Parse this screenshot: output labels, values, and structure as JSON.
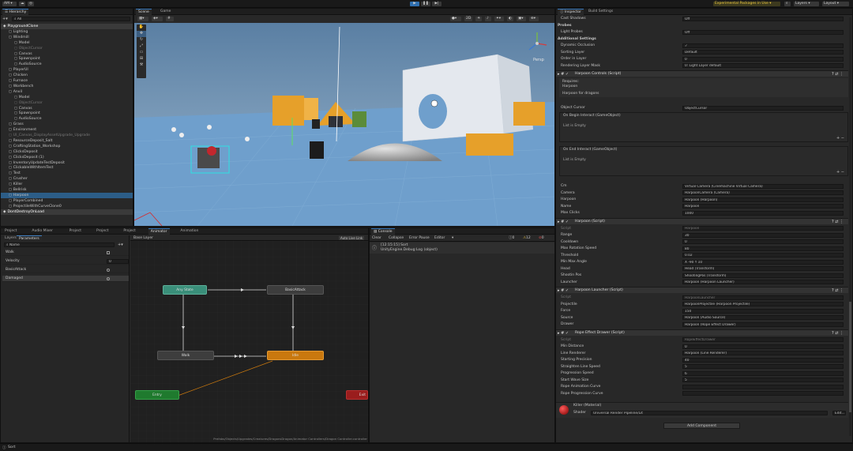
{
  "toolbar": {
    "account": "AM",
    "experimental": "Experimental Packages in Use",
    "layers": "Layers",
    "layout": "Layout"
  },
  "hierarchy": {
    "tab": "Hierarchy",
    "search_placeholder": "All",
    "items": [
      {
        "label": "PlaygroundClone",
        "indent": 0,
        "selected": true
      },
      {
        "label": "Lighting",
        "indent": 1
      },
      {
        "label": "Windmill",
        "indent": 1
      },
      {
        "label": "Model",
        "indent": 2
      },
      {
        "label": "ObjectCursor",
        "indent": 2,
        "dim": true
      },
      {
        "label": "Canvas",
        "indent": 2
      },
      {
        "label": "Spawnpoint",
        "indent": 2
      },
      {
        "label": "AudioSource",
        "indent": 2
      },
      {
        "label": "PlayerUI",
        "indent": 1
      },
      {
        "label": "Chicken",
        "indent": 1
      },
      {
        "label": "Furnace",
        "indent": 1
      },
      {
        "label": "Workbench",
        "indent": 1
      },
      {
        "label": "Anvil",
        "indent": 1
      },
      {
        "label": "Model",
        "indent": 2
      },
      {
        "label": "ObjectCursor",
        "indent": 2,
        "dim": true
      },
      {
        "label": "Canvas",
        "indent": 2
      },
      {
        "label": "Spawnpoint",
        "indent": 2
      },
      {
        "label": "AudioSource",
        "indent": 2
      },
      {
        "label": "Grass",
        "indent": 1
      },
      {
        "label": "Environment",
        "indent": 1
      },
      {
        "label": "UI_Canvas_DisplayAssetUpgrade_Upgrade",
        "indent": 1,
        "dim": true
      },
      {
        "label": "ResourceDeposit_Salt",
        "indent": 1
      },
      {
        "label": "CraftingStation_Workshop",
        "indent": 1
      },
      {
        "label": "ClicksDeposit",
        "indent": 1
      },
      {
        "label": "ClicksDeposit (1)",
        "indent": 1
      },
      {
        "label": "InventoryUpdateTestDeposit",
        "indent": 1
      },
      {
        "label": "ClickableWithItemTest",
        "indent": 1
      },
      {
        "label": "Test",
        "indent": 1
      },
      {
        "label": "Crusher",
        "indent": 1
      },
      {
        "label": "Killer",
        "indent": 1
      },
      {
        "label": "Bellrisk",
        "indent": 1
      },
      {
        "label": "Harpoon",
        "indent": 1,
        "highlight": true
      },
      {
        "label": "PlayerCombined",
        "indent": 1
      },
      {
        "label": "ProjectileWithCurveClone0",
        "indent": 1
      },
      {
        "label": "DontDestroyOnLoad",
        "indent": 0,
        "selected": true
      }
    ]
  },
  "scene": {
    "tabs": [
      "Scene",
      "Game"
    ],
    "persp": "Persp"
  },
  "bottom_left": {
    "tabs": [
      "Project",
      "Audio Mixer",
      "Project",
      "Project",
      "Project",
      "Animator",
      "Animation"
    ],
    "layers_tab": "Layers",
    "params_tab": "Parameters",
    "search_placeholder": "Name",
    "base_layer": "Base Layer",
    "auto_live": "Auto Live Link",
    "params": [
      {
        "name": "Walk",
        "type": "bool",
        "value": ""
      },
      {
        "name": "Velocity",
        "type": "float",
        "value": "0"
      },
      {
        "name": "BasicAttack",
        "type": "trigger",
        "value": ""
      },
      {
        "name": "Damaged",
        "type": "trigger",
        "value": ""
      }
    ],
    "nodes": {
      "any_state": "Any State",
      "basic_attack": "BasicAttack",
      "walk": "Walk",
      "idle": "Idle",
      "entry": "Entry",
      "exit": "Exit"
    },
    "path": "Prefabs/Objects/Upgrades/Creatures/DragonsDragon/Animator Controllers/Dragon Controller.controller"
  },
  "console": {
    "tab": "Console",
    "clear": "Clear",
    "collapse": "Collapse",
    "error_pause": "Error Pause",
    "editor": "Editor",
    "warn_count": "0",
    "err_count": "12",
    "info_count": "0",
    "log_line1": "[12:15:15] Sort",
    "log_line2": "UnityEngine.Debug:Log (object)"
  },
  "inspector": {
    "tabs": [
      "Inspector",
      "Build Settings"
    ],
    "top_rows": [
      {
        "label": "Cast Shadows",
        "value": "Off"
      },
      {
        "label": "Probes",
        "value": "",
        "header": true
      },
      {
        "label": "Light Probes",
        "value": "Off"
      },
      {
        "label": "Additional Settings",
        "value": "",
        "header": true
      },
      {
        "label": "Dynamic Occlusion",
        "value": "✓"
      },
      {
        "label": "Sorting Layer",
        "value": "Default"
      },
      {
        "label": "Order in Layer",
        "value": "0"
      },
      {
        "label": "Rendering Layer Mask",
        "value": "0: Light Layer default"
      }
    ],
    "harpoon_controls": {
      "title": "Harpoon Controls (Script)",
      "requires": "Requires:",
      "requires_val": "Harpoon",
      "for": "Harpoon for dragons",
      "object_cursor_label": "Object Cursor",
      "object_cursor": "ObjectCursor",
      "on_begin": "On Begin Interact (GameObject)",
      "list_empty1": "List is Empty",
      "on_end": "On End Interact (GameObject)",
      "list_empty2": "List is Empty",
      "rows": [
        {
          "label": "Cm",
          "value": "Virtual Camera (Cinemachine Virtual Camera)"
        },
        {
          "label": "Camera",
          "value": "HarpoonCamera (Camera)"
        },
        {
          "label": "Harpoon",
          "value": "Harpoon (Harpoon)"
        },
        {
          "label": "Name",
          "value": "Harpoon"
        },
        {
          "label": "Max Clicks",
          "value": "1000"
        }
      ]
    },
    "harpoon": {
      "title": "Harpoon (Script)",
      "rows": [
        {
          "label": "Script",
          "value": "Harpoon"
        },
        {
          "label": "Range",
          "value": "30"
        },
        {
          "label": "Cooldown",
          "value": "0"
        },
        {
          "label": "Max Rotation Speed",
          "value": "80"
        },
        {
          "label": "Threshold",
          "value": "0.02"
        },
        {
          "label": "Min Max Angle",
          "value": "X -90    Y 10"
        },
        {
          "label": "Head",
          "value": "Head (Transform)"
        },
        {
          "label": "Shootin Pos",
          "value": "ShootingPos (Transform)"
        },
        {
          "label": "Launcher",
          "value": "Harpoon (Harpoon Launcher)"
        }
      ]
    },
    "launcher": {
      "title": "Harpoon Launcher (Script)",
      "rows": [
        {
          "label": "Script",
          "value": "HarpoonLauncher"
        },
        {
          "label": "Projectile",
          "value": "HarpoonProjectile (Harpoon Projectile)"
        },
        {
          "label": "Force",
          "value": "150"
        },
        {
          "label": "Source",
          "value": "Harpoon (Audio Source)"
        },
        {
          "label": "Drawer",
          "value": "Harpoon (Rope Effect Drawer)"
        }
      ]
    },
    "rope": {
      "title": "Rope Effect Drawer (Script)",
      "rows": [
        {
          "label": "Script",
          "value": "RopeEffectDrawer"
        },
        {
          "label": "Min Distance",
          "value": "0"
        },
        {
          "label": "Line Renderer",
          "value": "Harpoon (Line Renderer)"
        },
        {
          "label": "Starting Precision",
          "value": "40"
        },
        {
          "label": "Straighten Line Speed",
          "value": "5"
        },
        {
          "label": "Progression Speed",
          "value": "6"
        },
        {
          "label": "Start Wave Size",
          "value": "5"
        },
        {
          "label": "Rope Animation Curve",
          "value": ""
        },
        {
          "label": "Rope Progression Curve",
          "value": ""
        }
      ]
    },
    "material": {
      "name": "Killer (Material)",
      "shader_label": "Shader",
      "shader": "Universal Render Pipeline/Lit",
      "edit": "Edit..."
    },
    "add_component": "Add Component"
  },
  "status": {
    "text": "Sort"
  },
  "colors": {
    "accent": "#3a79bb",
    "idle_node": "#c9780e",
    "entry_node": "#1f7a2e",
    "any_node": "#3a8f7a",
    "exit_node": "#9a1d1d"
  }
}
